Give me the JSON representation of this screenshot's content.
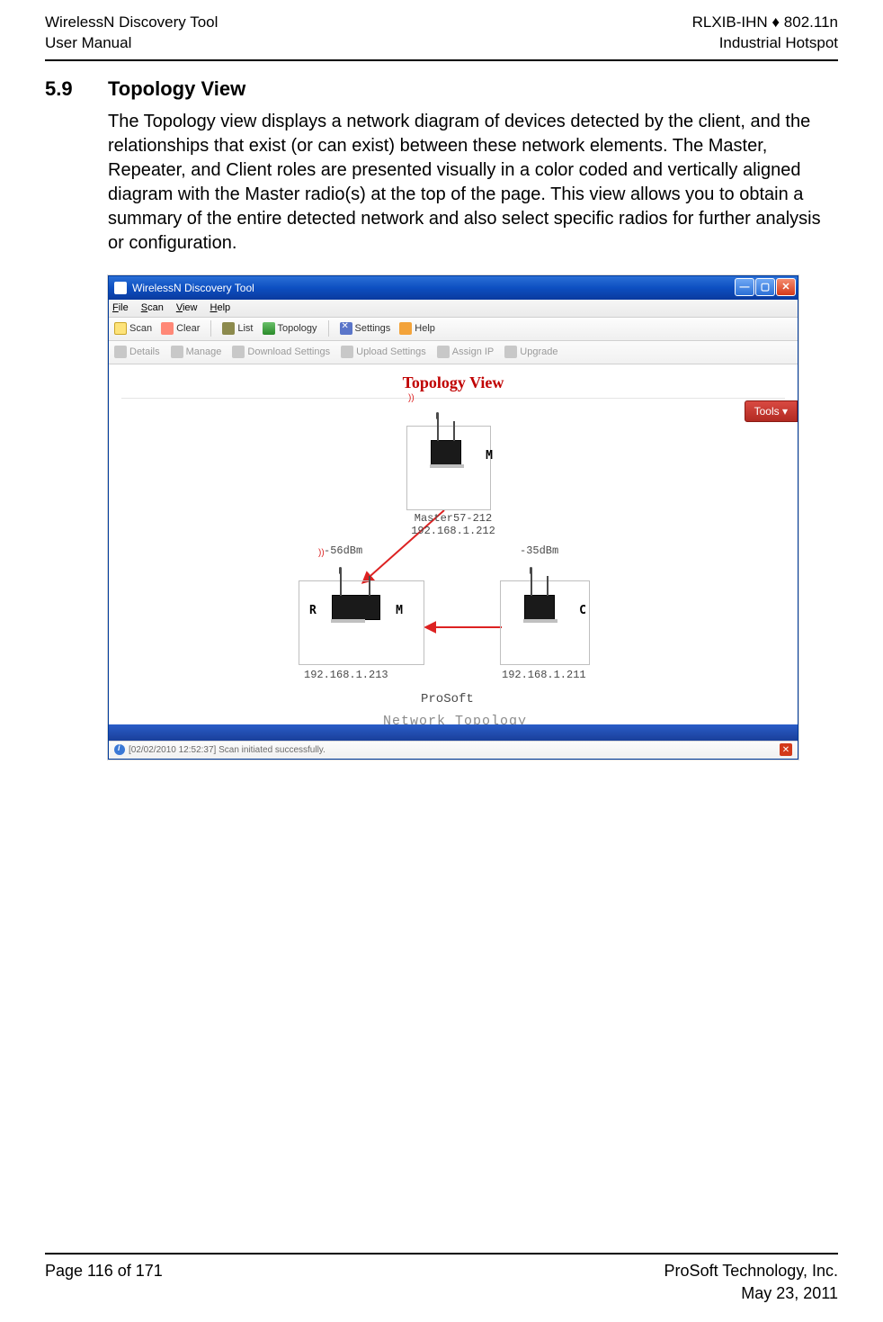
{
  "header": {
    "left_line1": "WirelessN Discovery Tool",
    "left_line2": "User Manual",
    "right_line1": "RLXIB-IHN ♦ 802.11n",
    "right_line2": "Industrial Hotspot"
  },
  "section": {
    "number": "5.9",
    "title": "Topology View",
    "body": "The Topology view displays a network diagram of devices detected by the client, and the relationships that exist (or can exist) between these network elements. The Master, Repeater, and Client roles are presented visually in a color coded and vertically aligned diagram with the Master radio(s) at the top of the page. This view allows you to obtain a summary of the entire detected network and also select specific radios for further analysis or configuration."
  },
  "screenshot": {
    "window_title": "WirelessN Discovery Tool",
    "menus": {
      "file": "File",
      "scan": "Scan",
      "view": "View",
      "help": "Help"
    },
    "toolbar1": {
      "scan": "Scan",
      "clear": "Clear",
      "list": "List",
      "topology": "Topology",
      "settings": "Settings",
      "help": "Help"
    },
    "toolbar2": {
      "details": "Details",
      "manage": "Manage",
      "download": "Download Settings",
      "upload": "Upload Settings",
      "assign_ip": "Assign IP",
      "upgrade": "Upgrade"
    },
    "content": {
      "heading": "Topology View",
      "tools_button": "Tools",
      "master": {
        "role": "M",
        "name": "Master57-212",
        "ip": "192.168.1.212"
      },
      "link_left_dbm": "-56dBm",
      "link_right_dbm": "-35dBm",
      "repeater": {
        "role_left": "R",
        "role_right": "M",
        "ip": "192.168.1.213"
      },
      "client": {
        "role": "C",
        "ip": "192.168.1.211"
      },
      "brand": "ProSoft",
      "caption": "Network Topology"
    },
    "status_text": "[02/02/2010 12:52:37] Scan initiated successfully."
  },
  "footer": {
    "page": "Page 116 of 171",
    "company": "ProSoft Technology, Inc.",
    "date": "May 23, 2011"
  }
}
